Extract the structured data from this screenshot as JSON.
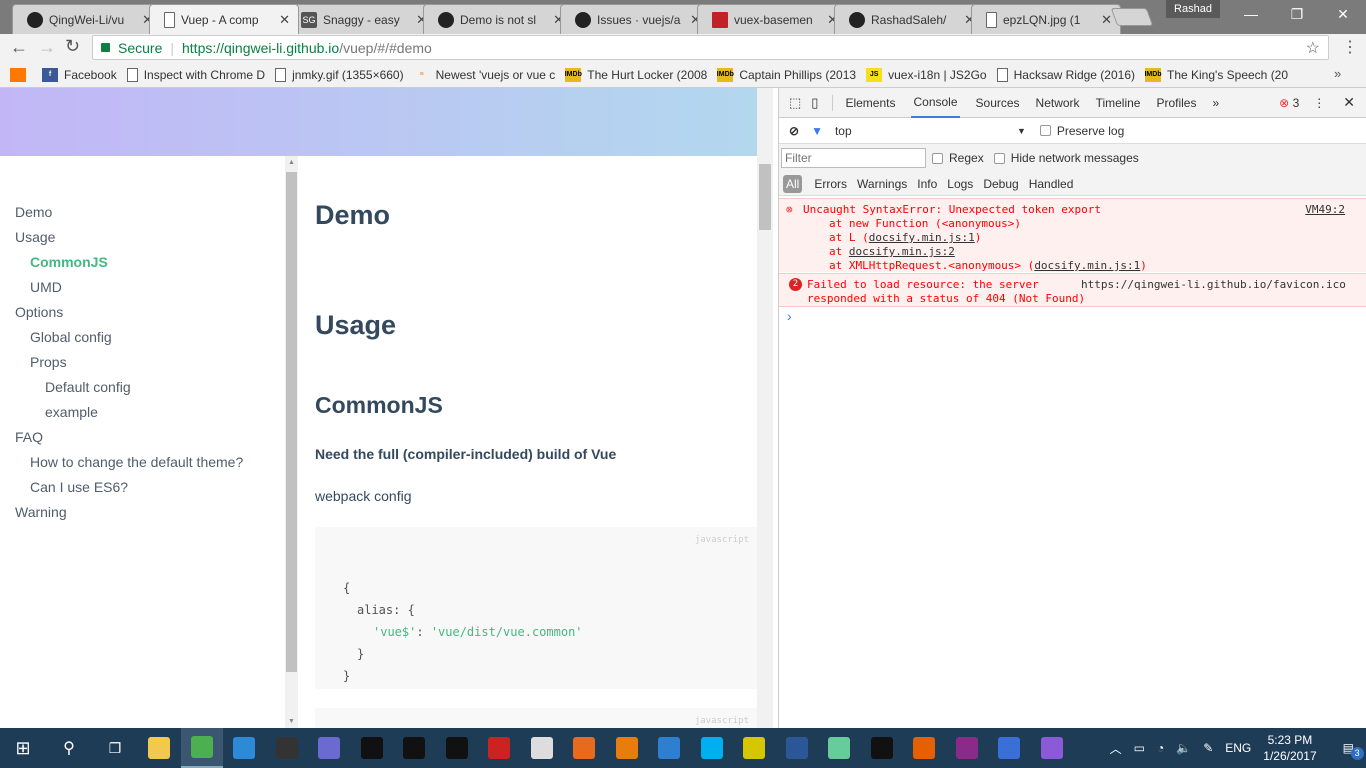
{
  "browser": {
    "tabs": [
      {
        "title": "QingWei-Li/vu",
        "icon": "github-icon"
      },
      {
        "title": "Vuep - A comp",
        "icon": "page-icon",
        "active": true
      },
      {
        "title": "Snaggy - easy",
        "icon": "snaggy-icon"
      },
      {
        "title": "Demo is not sl",
        "icon": "github-icon"
      },
      {
        "title": "Issues · vuejs/a",
        "icon": "github-icon"
      },
      {
        "title": "vuex-basemen",
        "icon": "npm-icon"
      },
      {
        "title": "RashadSaleh/",
        "icon": "github-icon"
      },
      {
        "title": "epzLQN.jpg (1",
        "icon": "page-icon"
      }
    ],
    "profile": "Rashad",
    "secure_label": "Secure",
    "url_host": "https://qingwei-li.github.io",
    "url_path": "/vuep/#/#demo",
    "bookmarks": [
      {
        "label": "",
        "icon": "orange-icon"
      },
      {
        "label": "Facebook",
        "icon": "facebook-icon"
      },
      {
        "label": "Inspect with Chrome D",
        "icon": "page-icon"
      },
      {
        "label": "jnmky.gif (1355×660)",
        "icon": "page-icon"
      },
      {
        "label": "Newest 'vuejs or vue c",
        "icon": "stackoverflow-icon"
      },
      {
        "label": "The Hurt Locker (2008",
        "icon": "imdb-icon"
      },
      {
        "label": "Captain Phillips (2013",
        "icon": "imdb-icon"
      },
      {
        "label": "vuex-i18n | JS2Go",
        "icon": "js2go-icon"
      },
      {
        "label": "Hacksaw Ridge (2016)",
        "icon": "page-icon"
      },
      {
        "label": "The King's Speech (20",
        "icon": "imdb-icon"
      }
    ]
  },
  "page": {
    "sidebar": [
      {
        "label": "Demo",
        "level": 0
      },
      {
        "label": "Usage",
        "level": 0
      },
      {
        "label": "CommonJS",
        "level": 1,
        "active": true
      },
      {
        "label": "UMD",
        "level": 1
      },
      {
        "label": "Options",
        "level": 0
      },
      {
        "label": "Global config",
        "level": 1
      },
      {
        "label": "Props",
        "level": 1
      },
      {
        "label": "Default config",
        "level": 2
      },
      {
        "label": "example",
        "level": 2
      },
      {
        "label": "FAQ",
        "level": 0
      },
      {
        "label": "How to change the default theme?",
        "level": 1
      },
      {
        "label": "Can I use ES6?",
        "level": 1
      },
      {
        "label": "Warning",
        "level": 0
      }
    ],
    "h_demo": "Demo",
    "h_usage": "Usage",
    "h_commonjs": "CommonJS",
    "p_full_build": "Need the full (compiler-included) build of Vue",
    "p_webpack": "webpack config",
    "code_lang": "javascript",
    "code": {
      "l1": "{",
      "l2": "alias: {",
      "key": "'vue$'",
      "colon": ": ",
      "val": "'vue/dist/vue.common'",
      "l4": "}",
      "l5": "}"
    },
    "accent": "#42b983"
  },
  "devtools": {
    "tabs": [
      "Elements",
      "Console",
      "Sources",
      "Network",
      "Timeline",
      "Profiles"
    ],
    "active_tab": "Console",
    "error_count": "3",
    "context": "top",
    "preserve_log": "Preserve log",
    "filter_placeholder": "Filter",
    "regex": "Regex",
    "hide_network": "Hide network messages",
    "levels": [
      "All",
      "Errors",
      "Warnings",
      "Info",
      "Logs",
      "Debug",
      "Handled"
    ],
    "messages": [
      {
        "text": "Uncaught SyntaxError: Unexpected token export",
        "source": "VM49:2",
        "stack": [
          "at new Function (<anonymous>)",
          "at L (",
          "docsify.min.js:1",
          ")",
          "at ",
          "docsify.min.js:2",
          "at XMLHttpRequest.<anonymous> (",
          "docsify.min.js:1",
          ")"
        ]
      },
      {
        "count": "2",
        "text1": "Failed to load resource: the server",
        "text2": "responded with a status of 404 (Not Found)",
        "source": "https://qingwei-li.github.io/favicon.ico"
      }
    ],
    "prompt": "›"
  },
  "taskbar": {
    "apps": [
      {
        "name": "file-explorer-icon",
        "color": "#f2c94c"
      },
      {
        "name": "chrome-icon",
        "color": "#4caf50"
      },
      {
        "name": "vscode-icon",
        "color": "#2d8ad6"
      },
      {
        "name": "obs-icon",
        "color": "#333"
      },
      {
        "name": "network-app-icon",
        "color": "#6a6ad0"
      },
      {
        "name": "terminal-icon",
        "color": "#111"
      },
      {
        "name": "terminal-icon",
        "color": "#111"
      },
      {
        "name": "terminal-icon",
        "color": "#111"
      },
      {
        "name": "app-red-icon",
        "color": "#c22"
      },
      {
        "name": "microphone-icon",
        "color": "#ddd"
      },
      {
        "name": "recorder-icon",
        "color": "#e86a1c"
      },
      {
        "name": "blender-icon",
        "color": "#e87d0d"
      },
      {
        "name": "news-icon",
        "color": "#2f7fd0"
      },
      {
        "name": "skype-icon",
        "color": "#00aff0"
      },
      {
        "name": "app-bee-icon",
        "color": "#d6c600"
      },
      {
        "name": "word-icon",
        "color": "#2b5797"
      },
      {
        "name": "atom-icon",
        "color": "#66cc99"
      },
      {
        "name": "terminal-icon",
        "color": "#111"
      },
      {
        "name": "firefox-icon",
        "color": "#e66000"
      },
      {
        "name": "winrar-icon",
        "color": "#8a2b8a"
      },
      {
        "name": "app-blue-icon",
        "color": "#3a6fd8"
      },
      {
        "name": "github-desktop-icon",
        "color": "#8a5ad8"
      }
    ],
    "lang": "ENG",
    "time": "5:23 PM",
    "date": "1/26/2017",
    "notifications": "3"
  }
}
